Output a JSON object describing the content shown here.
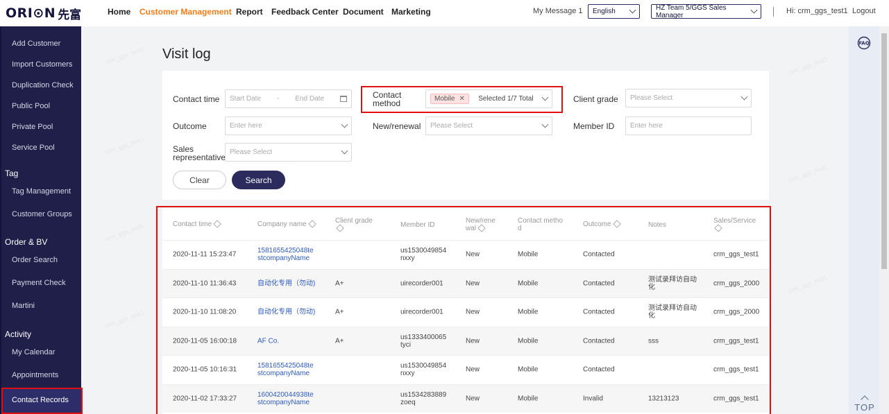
{
  "brand": {
    "logo": "ORI⊙N",
    "logo_cn": "先富"
  },
  "nav": [
    "Home",
    "Customer Management",
    "Report",
    "Feedback Center",
    "Document",
    "Marketing"
  ],
  "top_right": {
    "message": "My Message 1",
    "language": "English",
    "team": "HZ Team 5/GGS Sales Manager",
    "greeting": "Hi: crm_ggs_test1",
    "logout": "Logout"
  },
  "sidebar": {
    "items_customer": [
      "Add Customer",
      "Import Customers",
      "Duplication Check",
      "Public Pool",
      "Private Pool",
      "Service Pool"
    ],
    "tag_head": "Tag",
    "items_tag": [
      "Tag Management",
      "Customer Groups"
    ],
    "order_head": "Order & BV",
    "items_order": [
      "Order Search",
      "Payment Check",
      "Martini"
    ],
    "activity_head": "Activity",
    "items_activity": [
      "My Calendar",
      "Appointments"
    ],
    "active": "Contact Records"
  },
  "page": {
    "title": "Visit log"
  },
  "filters": {
    "contact_time_label": "Contact time",
    "start_placeholder": "Start Date",
    "range_sep": "-",
    "end_placeholder": "End Date",
    "contact_method_label": "Contact method",
    "contact_method_tag": "Mobile",
    "contact_method_tag_x": "✕",
    "contact_method_count": "Selected 1/7 Total",
    "client_grade_label": "Client grade",
    "client_grade_placeholder": "Please Select",
    "outcome_label": "Outcome",
    "outcome_placeholder": "Enter here",
    "new_renewal_label": "New/renewal",
    "new_renewal_placeholder": "Please Select",
    "member_id_label": "Member ID",
    "member_id_placeholder": "Enter here",
    "sales_rep_label": "Sales representative",
    "sales_rep_placeholder": "Please Select",
    "clear": "Clear",
    "search": "Search"
  },
  "table": {
    "headers": [
      "Contact time",
      "Company name",
      "Client grade",
      "Member ID",
      "New/renewal",
      "Contact method",
      "Outcome",
      "Notes",
      "Sales/Service"
    ],
    "rows": [
      [
        "2020-11-11 15:23:47",
        "1581655425048testcompanyName",
        "",
        "us1530049854nxxy",
        "New",
        "Mobile",
        "Contacted",
        "",
        "crm_ggs_test1"
      ],
      [
        "2020-11-10 11:36:43",
        "自动化专用（勿动)",
        "A+",
        "uirecorder001",
        "New",
        "Mobile",
        "Contacted",
        "测试录拜访自动化",
        "crm_ggs_2000"
      ],
      [
        "2020-11-10 11:08:20",
        "自动化专用（勿动)",
        "A+",
        "uirecorder001",
        "New",
        "Mobile",
        "Contacted",
        "测试录拜访自动化",
        "crm_ggs_2000"
      ],
      [
        "2020-11-05 16:00:18",
        "AF Co.",
        "A+",
        "us1333400065tyci",
        "New",
        "Mobile",
        "Contacted",
        "sss",
        "crm_ggs_test1"
      ],
      [
        "2020-11-05 10:16:31",
        "1581655425048testcompanyName",
        "",
        "us1530049854nxxy",
        "New",
        "Mobile",
        "Contacted",
        "",
        "crm_ggs_test1"
      ],
      [
        "2020-11-02 17:33:27",
        "1600420044938testcompanyName",
        "",
        "us1534283889zoeq",
        "New",
        "Mobile",
        "Invalid",
        "13213123",
        "crm_ggs_test1"
      ]
    ]
  },
  "rail": {
    "faq": "FAQ",
    "top": "TOP"
  },
  "watermark": "crm_ggs_test1",
  "colors": {
    "accent": "#f07d1a",
    "sidebar": "#1f1f4a",
    "primary_button": "#2b2b5e",
    "highlight_box": "#e01010",
    "link": "#2d5bbd"
  }
}
